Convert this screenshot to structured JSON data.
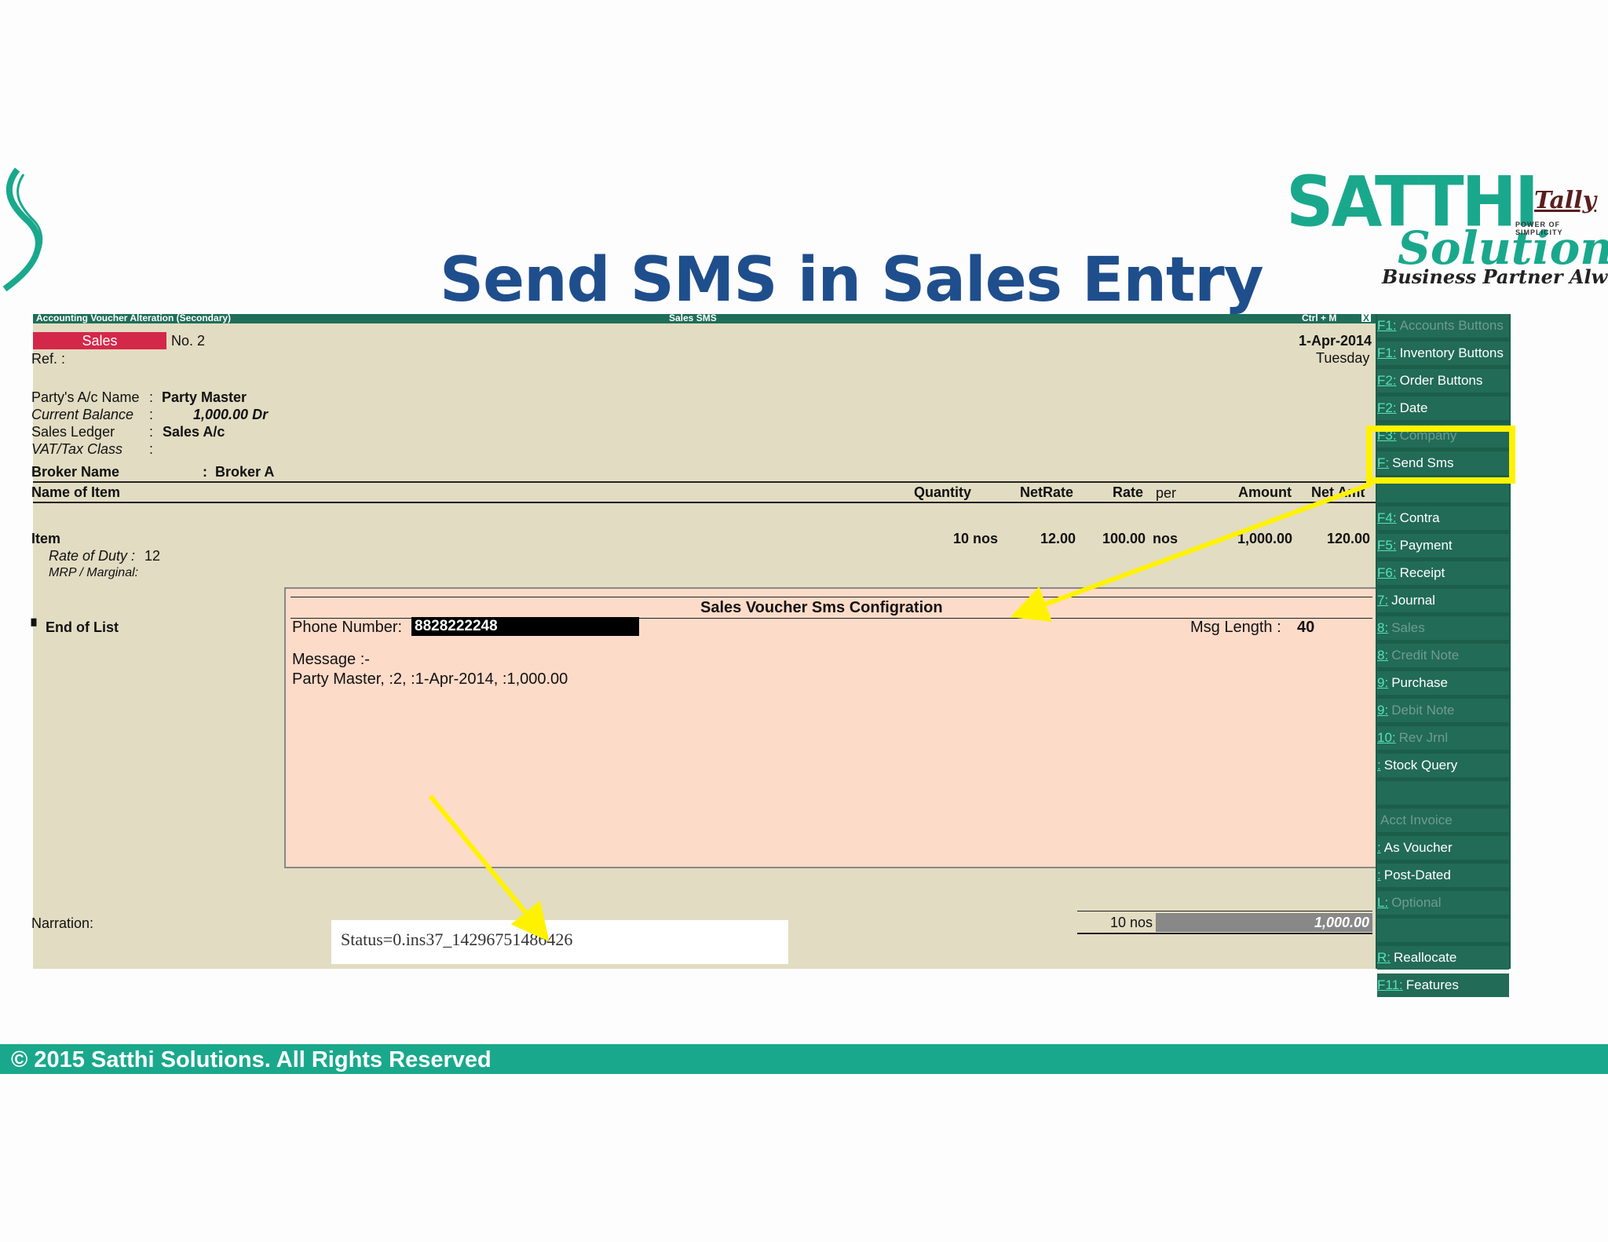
{
  "slide": {
    "title": "Send SMS in Sales Entry",
    "brand_name": "SATTHI",
    "brand_sub": "Solutions",
    "brand_tagline": "Business Partner Always",
    "tally_logo": "Tally",
    "tally_tagline": "POWER OF SIMPLICITY",
    "footer": "© 2015 Satthi Solutions. All Rights Reserved"
  },
  "window": {
    "title": "Accounting Voucher Alteration (Secondary)",
    "center_title": "Sales SMS",
    "shortcut": "Ctrl + M",
    "close": "X"
  },
  "voucher": {
    "type": "Sales",
    "number": "No. 2",
    "ref_label": "Ref. :",
    "date": "1-Apr-2014",
    "day": "Tuesday",
    "party_label": "Party's A/c Name",
    "party_value": "Party Master",
    "balance_label": "Current Balance",
    "balance_value": "1,000.00 Dr",
    "ledger_label": "Sales Ledger",
    "ledger_value": "Sales A/c",
    "vat_label": "VAT/Tax Class",
    "sep": ":",
    "broker_label": "Broker Name",
    "broker_value": "Broker A"
  },
  "table": {
    "headers": {
      "name": "Name of Item",
      "quantity": "Quantity",
      "netrate": "NetRate",
      "rate": "Rate",
      "per": "per",
      "amount": "Amount",
      "net_amt": "Net Amt"
    },
    "row": {
      "name": "Item",
      "quantity": "10 nos",
      "netrate": "12.00",
      "rate": "100.00",
      "per": "nos",
      "amount": "1,000.00",
      "net_amt": "120.00"
    },
    "rate_of_duty_label": "Rate of Duty :",
    "rate_of_duty_value": "12",
    "mrp_label": "MRP / Marginal:",
    "end_of_list": "End of List",
    "narration_label": "Narration:",
    "total_qty": "10 nos",
    "total_amount": "1,000.00"
  },
  "sms_popup": {
    "title": "Sales Voucher Sms Configration",
    "phone_label": "Phone Number:",
    "phone_value": "8828222248",
    "msg_length_label": "Msg Length :",
    "msg_length_value": "40",
    "message_label": "Message :-",
    "message_text": "Party Master, :2, :1-Apr-2014, :1,000.00"
  },
  "status": "Status=0.ins37_14296751486426",
  "sidebar": {
    "items": [
      {
        "key": "F1:",
        "label": "Accounts Buttons",
        "dim": true
      },
      {
        "key": "F1:",
        "label": "Inventory Buttons",
        "dim": false
      },
      {
        "key": "F2:",
        "label": "Order Buttons",
        "dim": false
      },
      {
        "key": "F2:",
        "label": "Date",
        "dim": false
      },
      {
        "key": "F3:",
        "label": "Company",
        "dim": true
      },
      {
        "key": "F:",
        "label": "Send Sms",
        "dim": false
      },
      {
        "key": "",
        "label": "",
        "dim": false
      },
      {
        "key": "F4:",
        "label": "Contra",
        "dim": false
      },
      {
        "key": "F5:",
        "label": "Payment",
        "dim": false
      },
      {
        "key": "F6:",
        "label": "Receipt",
        "dim": false
      },
      {
        "key": "7:",
        "label": "Journal",
        "dim": false
      },
      {
        "key": "8:",
        "label": "Sales",
        "dim": true
      },
      {
        "key": "8:",
        "label": "Credit Note",
        "dim": true
      },
      {
        "key": "9:",
        "label": "Purchase",
        "dim": false
      },
      {
        "key": "9:",
        "label": "Debit Note",
        "dim": true
      },
      {
        "key": "10:",
        "label": "Rev Jrnl",
        "dim": true
      },
      {
        "key": ":",
        "label": "Stock Query",
        "dim": false
      },
      {
        "key": "",
        "label": "",
        "dim": false
      },
      {
        "key": "",
        "label": "Acct Invoice",
        "dim": true
      },
      {
        "key": ":",
        "label": "As Voucher",
        "dim": false
      },
      {
        "key": ":",
        "label": "Post-Dated",
        "dim": false
      },
      {
        "key": "L:",
        "label": "Optional",
        "dim": true
      },
      {
        "key": "",
        "label": "",
        "dim": false
      },
      {
        "key": "R:",
        "label": "Reallocate",
        "dim": false
      },
      {
        "key": "F11:",
        "label": "Features",
        "dim": false
      }
    ]
  },
  "colors": {
    "accent": "#1aa88c",
    "title": "#1f4e8c",
    "sales_badge": "#d4284a",
    "highlight": "#fff200",
    "popup_bg": "#fddbc9",
    "app_bg": "#e2dcc2"
  }
}
